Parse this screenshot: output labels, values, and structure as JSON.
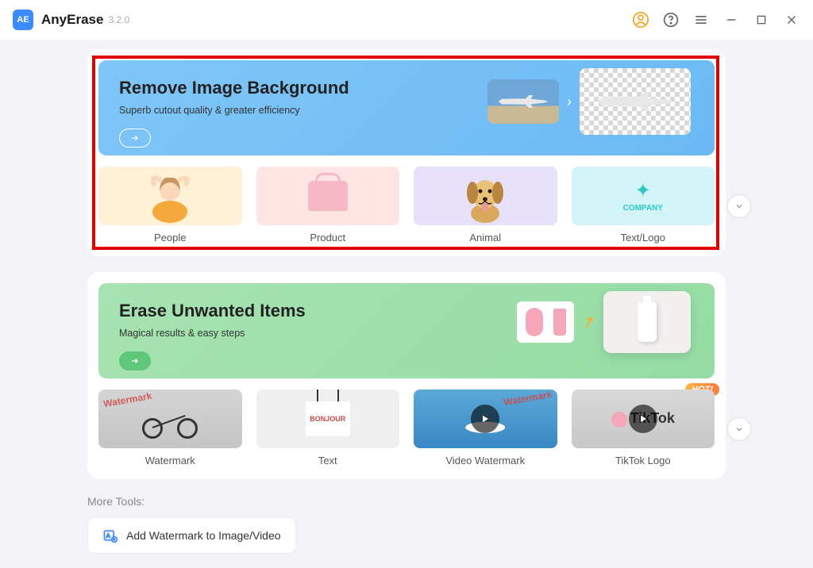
{
  "app": {
    "name": "AnyErase",
    "version": "3.2.0"
  },
  "section1": {
    "title": "Remove Image Background",
    "subtitle": "Superb cutout quality & greater efficiency",
    "tiles": {
      "people": "People",
      "product": "Product",
      "animal": "Animal",
      "textlogo": "Text/Logo",
      "logo_company": "COMPANY"
    }
  },
  "section2": {
    "title": "Erase Unwanted Items",
    "subtitle": "Magical results & easy steps",
    "tiles": {
      "watermark": "Watermark",
      "text": "Text",
      "video_watermark": "Video Watermark",
      "tiktok_logo": "TikTok Logo",
      "wm_overlay": "Watermark",
      "bonjour": "BONJOUR",
      "tiktok_brand": "TikTok",
      "hot": "HOT!"
    }
  },
  "more": {
    "label": "More Tools:",
    "add_watermark": "Add Watermark to Image/Video"
  }
}
